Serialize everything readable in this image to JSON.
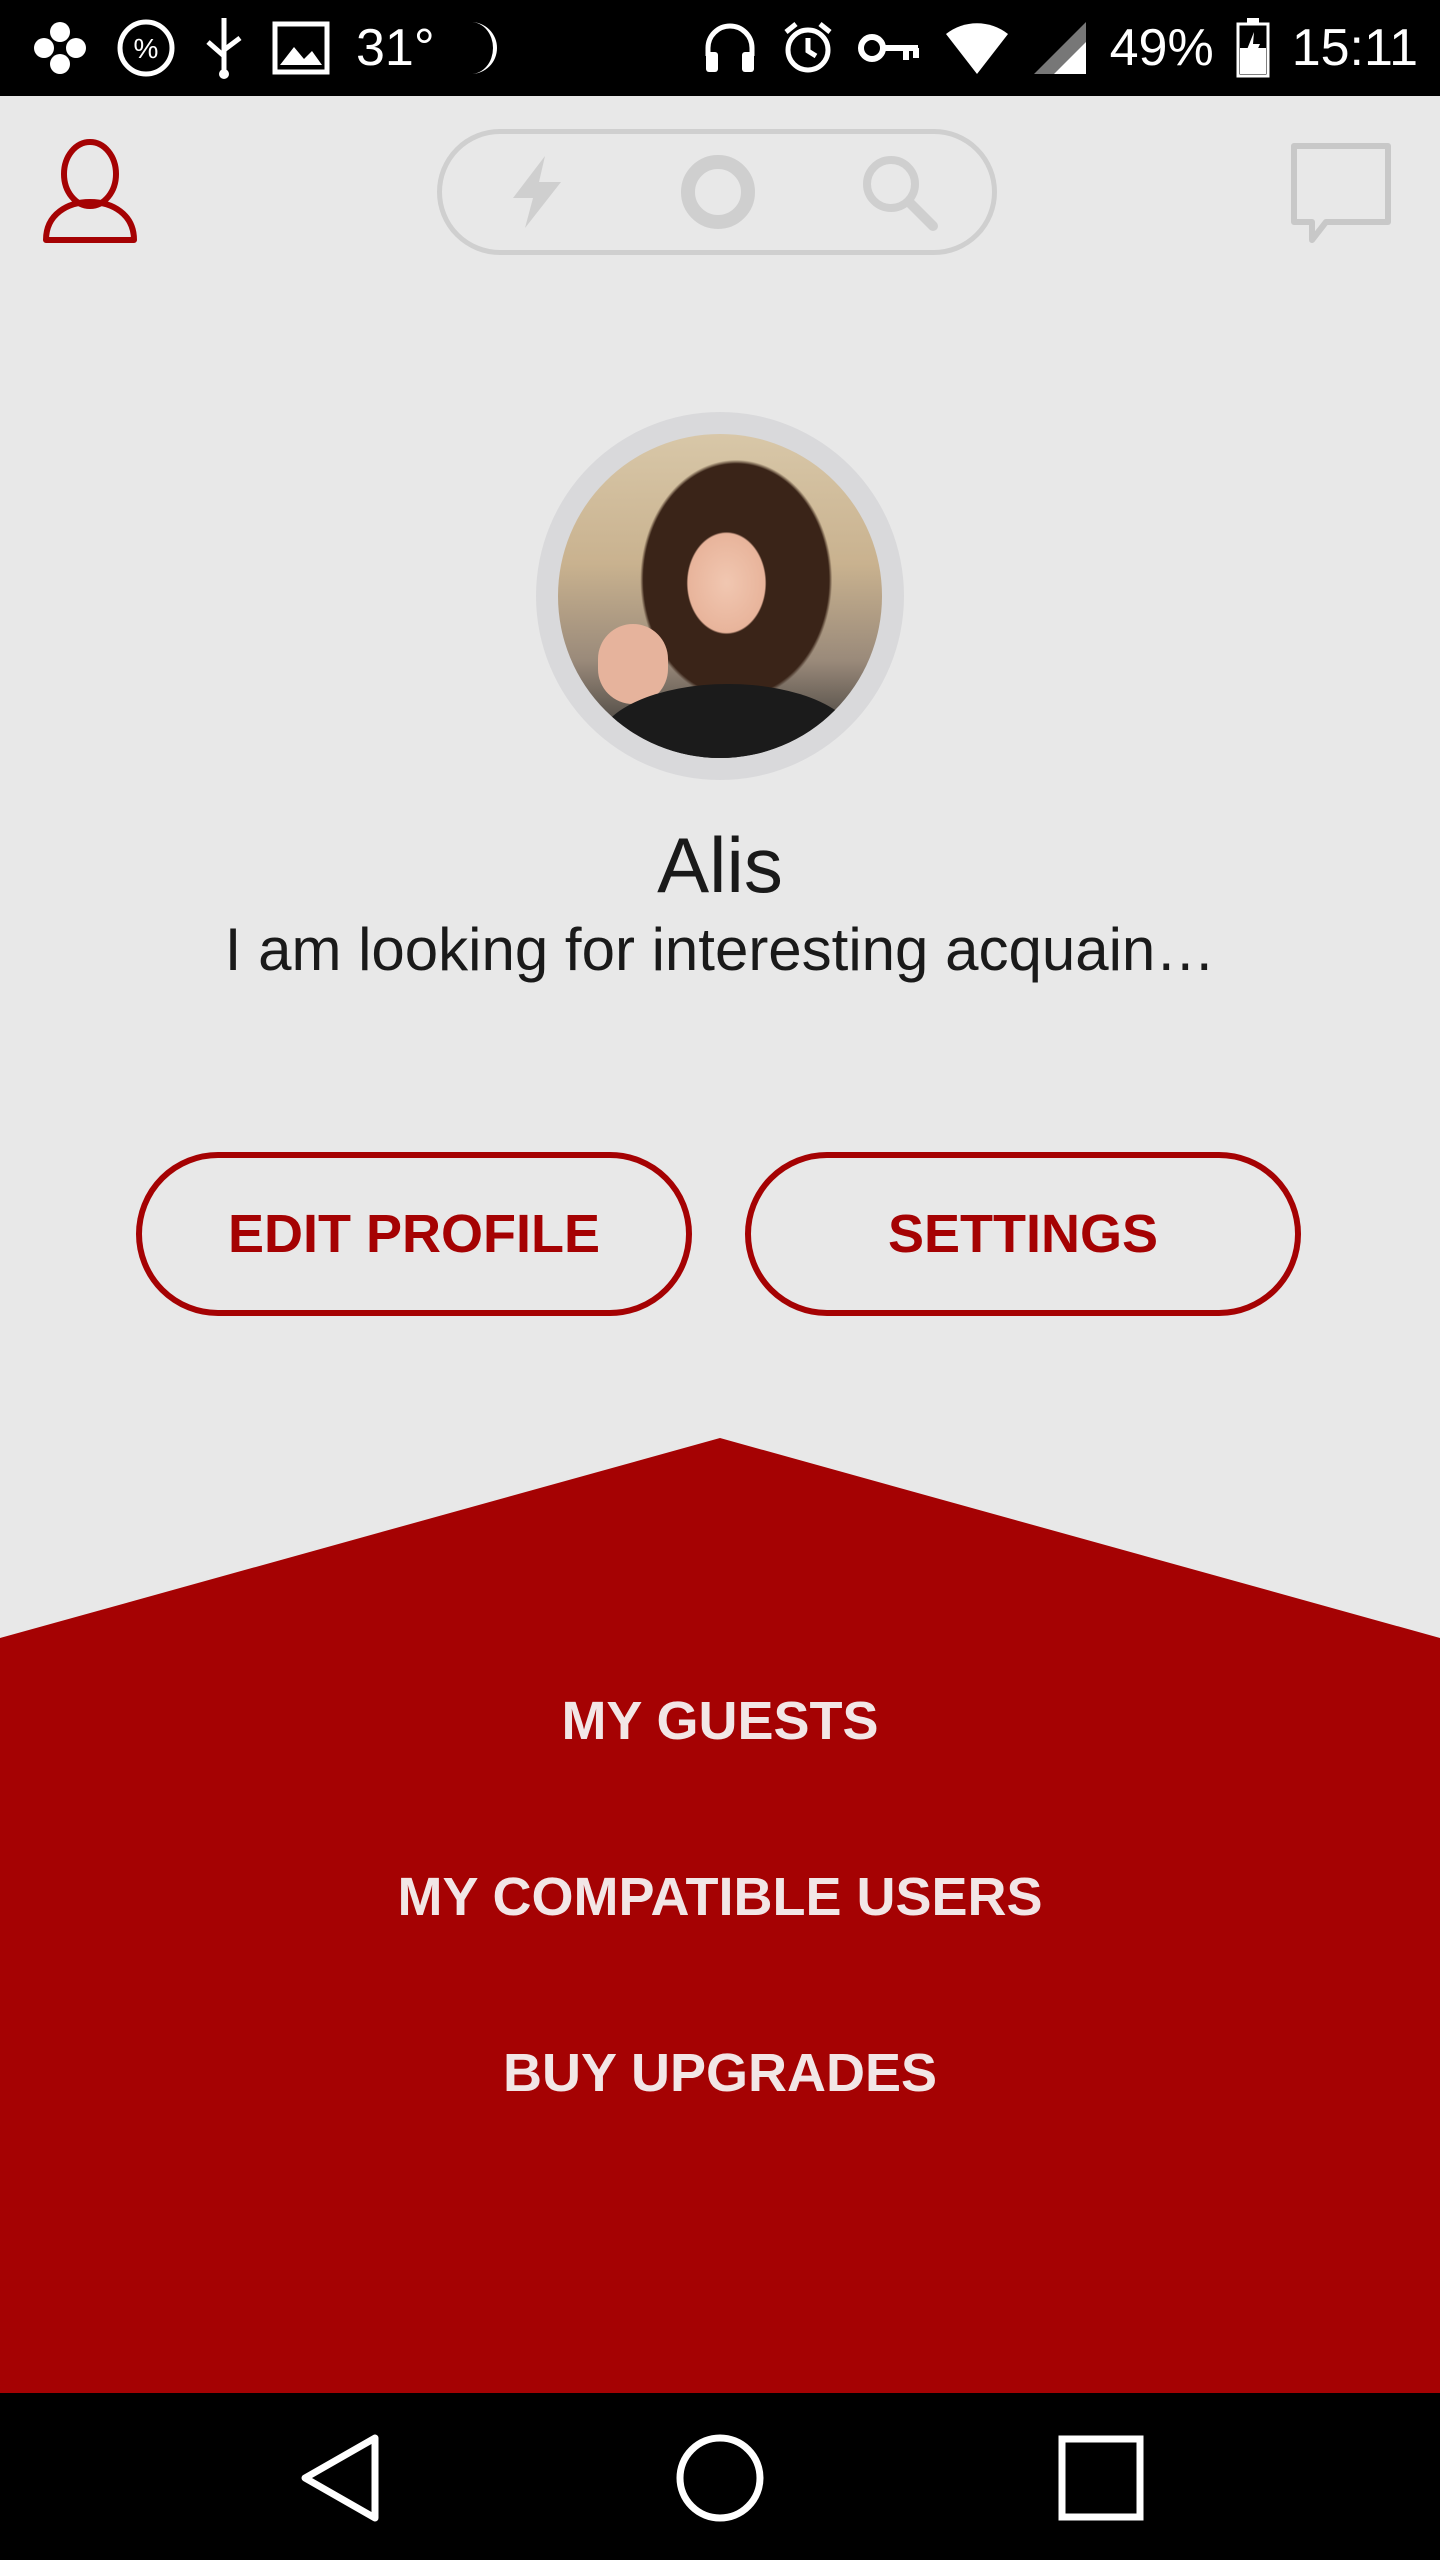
{
  "status_bar": {
    "temperature": "31°",
    "battery": "49%",
    "time": "15:11",
    "left_icons": [
      "app-icon",
      "percent-icon",
      "usb-icon",
      "image-icon",
      "temperature-text",
      "moon-icon"
    ],
    "right_icons": [
      "headphones-icon",
      "alarm-icon",
      "key-icon",
      "wifi-icon",
      "signal-icon",
      "battery-icon"
    ]
  },
  "top_bar": {
    "mode_switch": [
      "lightning-icon",
      "circle-icon",
      "search-icon"
    ]
  },
  "profile": {
    "name": "Alis",
    "bio": "I am looking for interesting acquain…"
  },
  "actions": {
    "edit_profile": "EDIT PROFILE",
    "settings": "SETTINGS"
  },
  "menu": {
    "items": [
      "MY GUESTS",
      "MY COMPATIBLE USERS",
      "BUY UPGRADES"
    ]
  },
  "colors": {
    "accent": "#a50203",
    "background": "#e8e8e8",
    "menu_text": "#f2e6e6"
  }
}
